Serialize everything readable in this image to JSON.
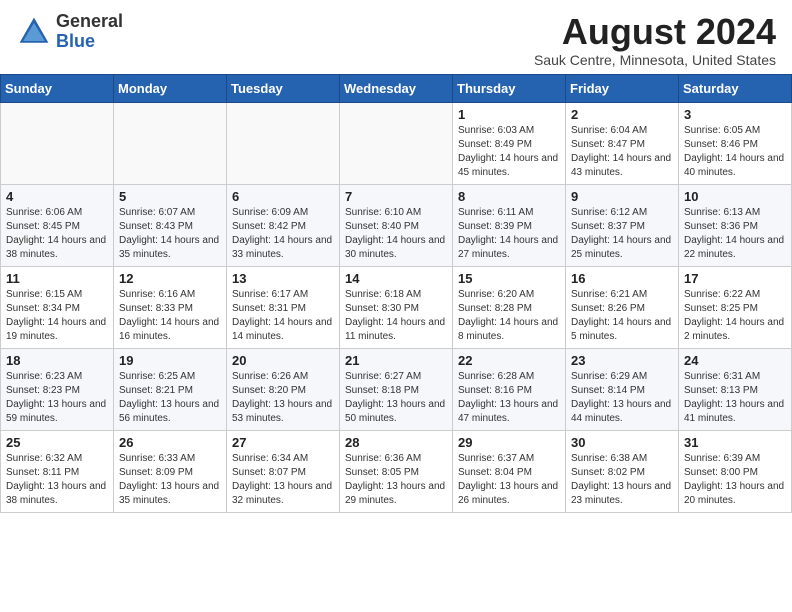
{
  "header": {
    "logo_general": "General",
    "logo_blue": "Blue",
    "month_year": "August 2024",
    "location": "Sauk Centre, Minnesota, United States"
  },
  "calendar": {
    "days_of_week": [
      "Sunday",
      "Monday",
      "Tuesday",
      "Wednesday",
      "Thursday",
      "Friday",
      "Saturday"
    ],
    "weeks": [
      [
        {
          "day": "",
          "info": ""
        },
        {
          "day": "",
          "info": ""
        },
        {
          "day": "",
          "info": ""
        },
        {
          "day": "",
          "info": ""
        },
        {
          "day": "1",
          "info": "Sunrise: 6:03 AM\nSunset: 8:49 PM\nDaylight: 14 hours and 45 minutes."
        },
        {
          "day": "2",
          "info": "Sunrise: 6:04 AM\nSunset: 8:47 PM\nDaylight: 14 hours and 43 minutes."
        },
        {
          "day": "3",
          "info": "Sunrise: 6:05 AM\nSunset: 8:46 PM\nDaylight: 14 hours and 40 minutes."
        }
      ],
      [
        {
          "day": "4",
          "info": "Sunrise: 6:06 AM\nSunset: 8:45 PM\nDaylight: 14 hours and 38 minutes."
        },
        {
          "day": "5",
          "info": "Sunrise: 6:07 AM\nSunset: 8:43 PM\nDaylight: 14 hours and 35 minutes."
        },
        {
          "day": "6",
          "info": "Sunrise: 6:09 AM\nSunset: 8:42 PM\nDaylight: 14 hours and 33 minutes."
        },
        {
          "day": "7",
          "info": "Sunrise: 6:10 AM\nSunset: 8:40 PM\nDaylight: 14 hours and 30 minutes."
        },
        {
          "day": "8",
          "info": "Sunrise: 6:11 AM\nSunset: 8:39 PM\nDaylight: 14 hours and 27 minutes."
        },
        {
          "day": "9",
          "info": "Sunrise: 6:12 AM\nSunset: 8:37 PM\nDaylight: 14 hours and 25 minutes."
        },
        {
          "day": "10",
          "info": "Sunrise: 6:13 AM\nSunset: 8:36 PM\nDaylight: 14 hours and 22 minutes."
        }
      ],
      [
        {
          "day": "11",
          "info": "Sunrise: 6:15 AM\nSunset: 8:34 PM\nDaylight: 14 hours and 19 minutes."
        },
        {
          "day": "12",
          "info": "Sunrise: 6:16 AM\nSunset: 8:33 PM\nDaylight: 14 hours and 16 minutes."
        },
        {
          "day": "13",
          "info": "Sunrise: 6:17 AM\nSunset: 8:31 PM\nDaylight: 14 hours and 14 minutes."
        },
        {
          "day": "14",
          "info": "Sunrise: 6:18 AM\nSunset: 8:30 PM\nDaylight: 14 hours and 11 minutes."
        },
        {
          "day": "15",
          "info": "Sunrise: 6:20 AM\nSunset: 8:28 PM\nDaylight: 14 hours and 8 minutes."
        },
        {
          "day": "16",
          "info": "Sunrise: 6:21 AM\nSunset: 8:26 PM\nDaylight: 14 hours and 5 minutes."
        },
        {
          "day": "17",
          "info": "Sunrise: 6:22 AM\nSunset: 8:25 PM\nDaylight: 14 hours and 2 minutes."
        }
      ],
      [
        {
          "day": "18",
          "info": "Sunrise: 6:23 AM\nSunset: 8:23 PM\nDaylight: 13 hours and 59 minutes."
        },
        {
          "day": "19",
          "info": "Sunrise: 6:25 AM\nSunset: 8:21 PM\nDaylight: 13 hours and 56 minutes."
        },
        {
          "day": "20",
          "info": "Sunrise: 6:26 AM\nSunset: 8:20 PM\nDaylight: 13 hours and 53 minutes."
        },
        {
          "day": "21",
          "info": "Sunrise: 6:27 AM\nSunset: 8:18 PM\nDaylight: 13 hours and 50 minutes."
        },
        {
          "day": "22",
          "info": "Sunrise: 6:28 AM\nSunset: 8:16 PM\nDaylight: 13 hours and 47 minutes."
        },
        {
          "day": "23",
          "info": "Sunrise: 6:29 AM\nSunset: 8:14 PM\nDaylight: 13 hours and 44 minutes."
        },
        {
          "day": "24",
          "info": "Sunrise: 6:31 AM\nSunset: 8:13 PM\nDaylight: 13 hours and 41 minutes."
        }
      ],
      [
        {
          "day": "25",
          "info": "Sunrise: 6:32 AM\nSunset: 8:11 PM\nDaylight: 13 hours and 38 minutes."
        },
        {
          "day": "26",
          "info": "Sunrise: 6:33 AM\nSunset: 8:09 PM\nDaylight: 13 hours and 35 minutes."
        },
        {
          "day": "27",
          "info": "Sunrise: 6:34 AM\nSunset: 8:07 PM\nDaylight: 13 hours and 32 minutes."
        },
        {
          "day": "28",
          "info": "Sunrise: 6:36 AM\nSunset: 8:05 PM\nDaylight: 13 hours and 29 minutes."
        },
        {
          "day": "29",
          "info": "Sunrise: 6:37 AM\nSunset: 8:04 PM\nDaylight: 13 hours and 26 minutes."
        },
        {
          "day": "30",
          "info": "Sunrise: 6:38 AM\nSunset: 8:02 PM\nDaylight: 13 hours and 23 minutes."
        },
        {
          "day": "31",
          "info": "Sunrise: 6:39 AM\nSunset: 8:00 PM\nDaylight: 13 hours and 20 minutes."
        }
      ]
    ]
  }
}
